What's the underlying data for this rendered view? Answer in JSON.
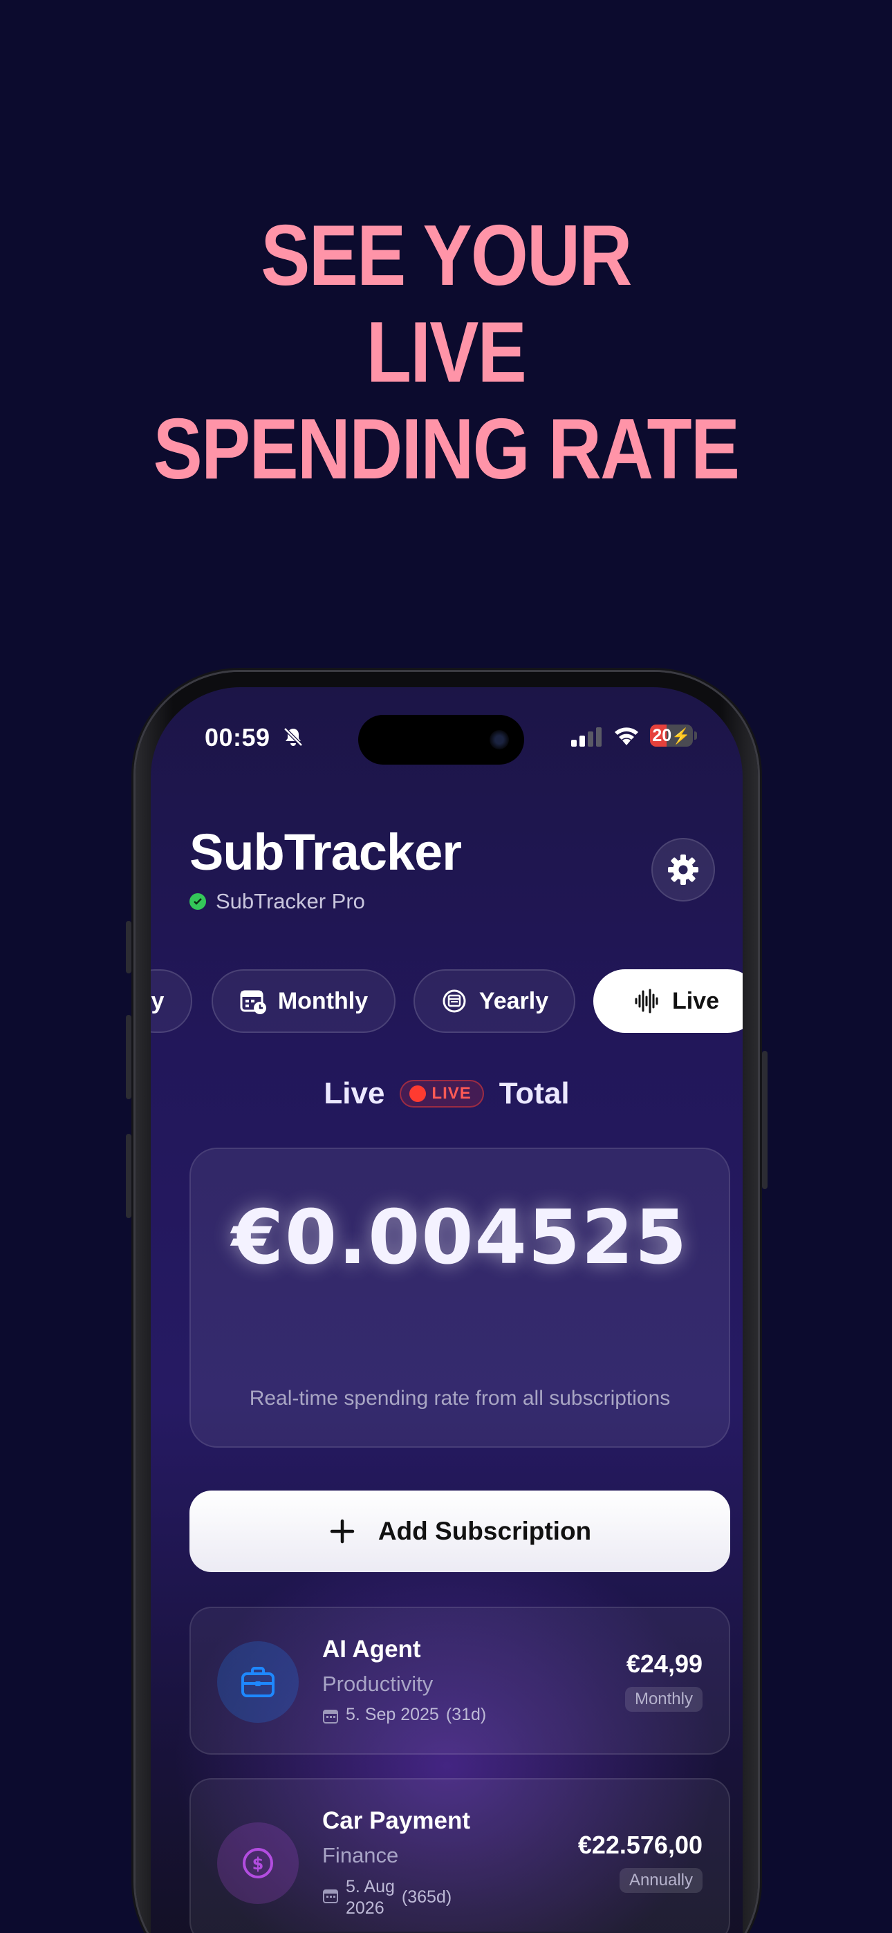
{
  "headline": [
    "SEE YOUR",
    "LIVE",
    "SPENDING RATE"
  ],
  "status_bar": {
    "time": "00:59",
    "battery": "20"
  },
  "app": {
    "title": "SubTracker",
    "pro_label": "SubTracker Pro"
  },
  "tabs": [
    {
      "label": "y",
      "icon": "partial-tab"
    },
    {
      "label": "Monthly",
      "icon": "calendar-clock-icon"
    },
    {
      "label": "Yearly",
      "icon": "calendar-circle-icon"
    },
    {
      "label": "Live",
      "icon": "waveform-icon",
      "active": true
    }
  ],
  "live_section": {
    "left": "Live",
    "badge": "LIVE",
    "right": "Total"
  },
  "total": {
    "amount": "€0.004525",
    "caption": "Real-time spending rate from all subscriptions"
  },
  "add_button": {
    "label": "Add Subscription"
  },
  "subscriptions": [
    {
      "name": "AI Agent",
      "category": "Productivity",
      "date": "5. Sep 2025",
      "days": "(31d)",
      "price": "€24,99",
      "period": "Monthly",
      "icon": "briefcase-icon",
      "color": "#1e88ff"
    },
    {
      "name": "Car Payment",
      "category": "Finance",
      "date_line1": "5. Aug",
      "date_line2": "2026",
      "days": "(365d)",
      "price": "€22.576,00",
      "period": "Annually",
      "icon": "dollar-circle-icon",
      "color": "#b34de0"
    }
  ]
}
